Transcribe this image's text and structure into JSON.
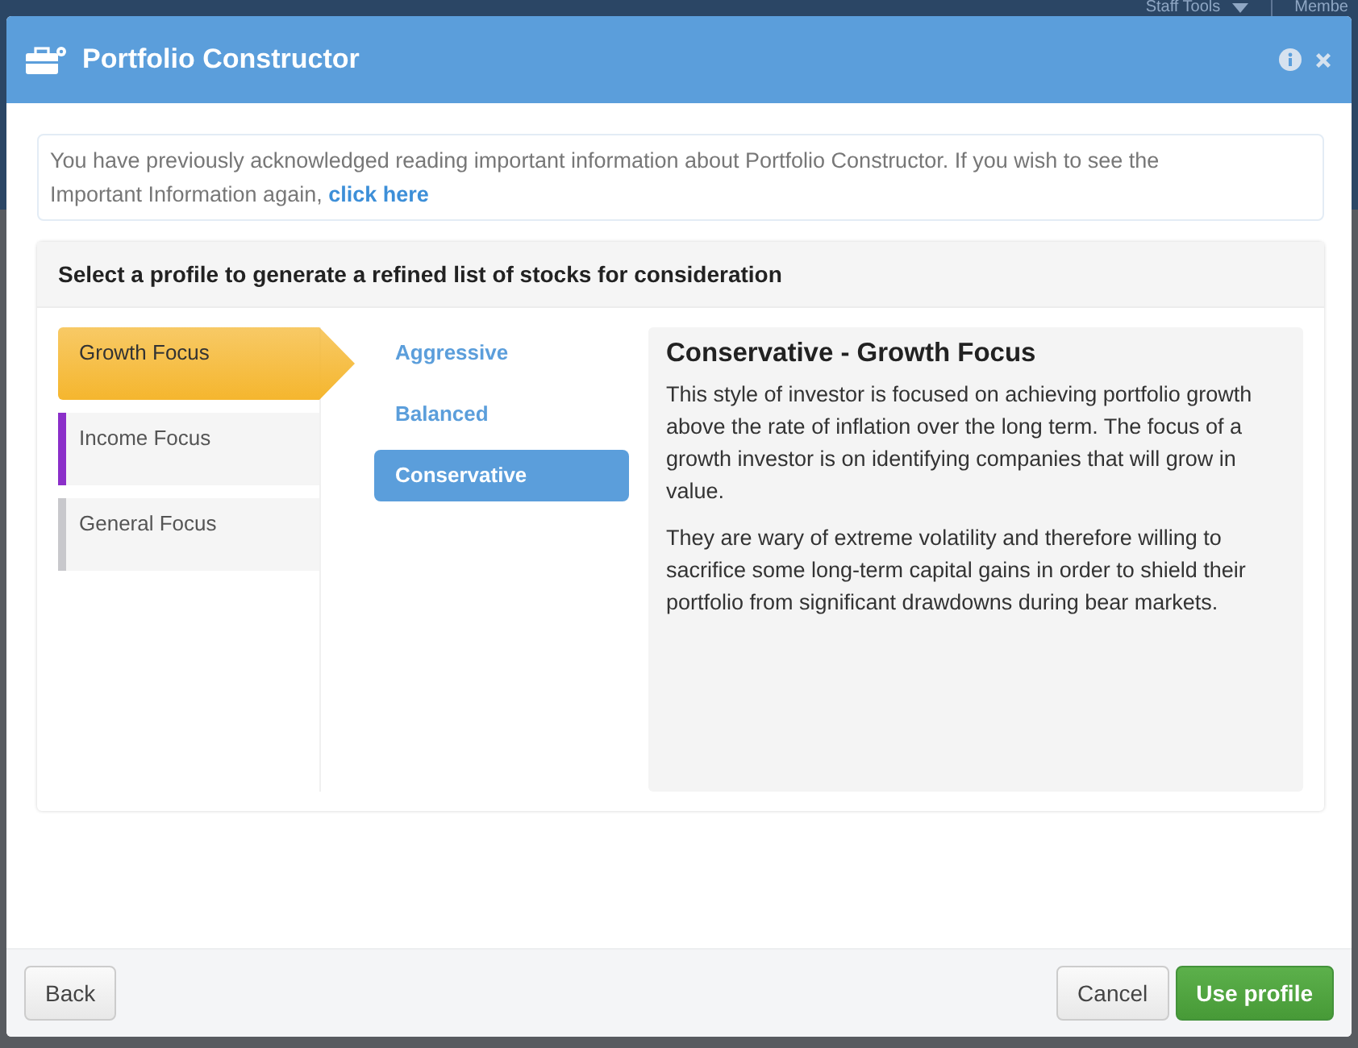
{
  "backdrop": {
    "nav_items": [
      "Staff Tools",
      "Membe"
    ]
  },
  "window": {
    "title": "Portfolio Constructor"
  },
  "notice": {
    "text": "You have previously acknowledged reading important information about Portfolio Constructor. If you wish to see the Important Information again,",
    "link": "click here"
  },
  "panel": {
    "heading": "Select a profile to generate a refined list of stocks for consideration",
    "categories": [
      {
        "label": "Growth Focus",
        "selected": true,
        "color": "#f5b62e"
      },
      {
        "label": "Income Focus",
        "selected": false,
        "color": "#8b2fc9"
      },
      {
        "label": "General Focus",
        "selected": false,
        "color": "#c8c8cc"
      }
    ],
    "profiles": [
      {
        "label": "Aggressive",
        "selected": false
      },
      {
        "label": "Balanced",
        "selected": false
      },
      {
        "label": "Conservative",
        "selected": true
      }
    ],
    "detail": {
      "title": "Conservative - Growth Focus",
      "paragraphs": [
        "This style of investor is focused on achieving portfolio growth above the rate of inflation over the long term. The focus of a growth investor is on identifying companies that will grow in value.",
        "They are wary of extreme volatility and therefore willing to sacrifice some long-term capital gains in order to shield their portfolio from significant drawdowns during bear markets."
      ]
    }
  },
  "footer": {
    "back": "Back",
    "cancel": "Cancel",
    "confirm": "Use profile"
  }
}
